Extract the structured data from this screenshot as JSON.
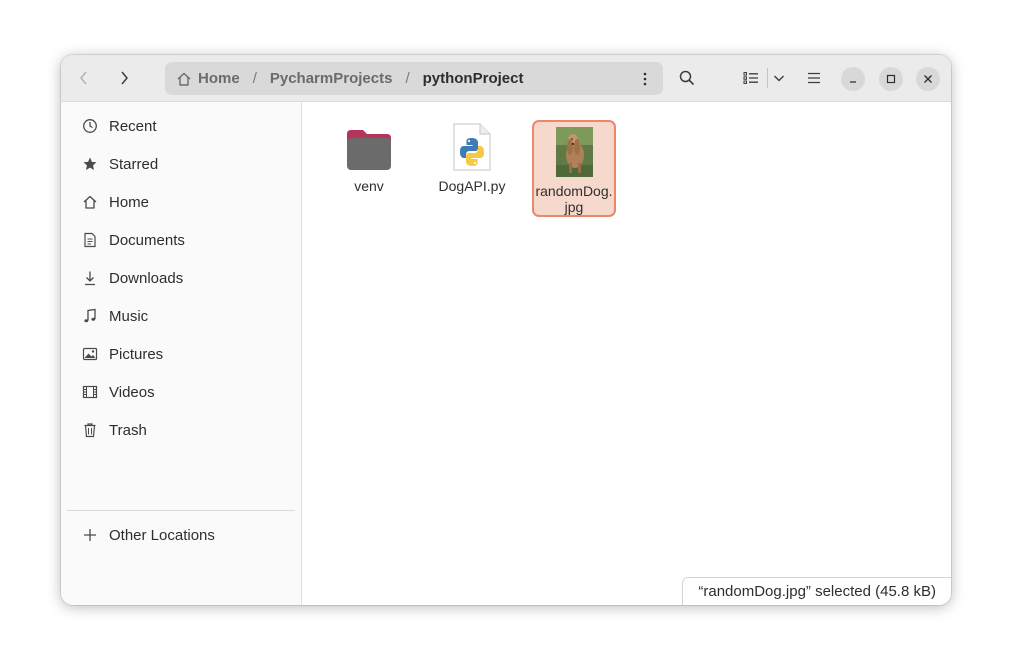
{
  "header": {
    "breadcrumbs": [
      {
        "label": "Home",
        "icon": "home-icon"
      },
      {
        "label": "PycharmProjects"
      },
      {
        "label": "pythonProject"
      }
    ],
    "separator": "/"
  },
  "sidebar": {
    "items": [
      {
        "label": "Recent",
        "icon": "clock-icon"
      },
      {
        "label": "Starred",
        "icon": "star-icon"
      },
      {
        "label": "Home",
        "icon": "home-icon"
      },
      {
        "label": "Documents",
        "icon": "document-icon"
      },
      {
        "label": "Downloads",
        "icon": "download-icon"
      },
      {
        "label": "Music",
        "icon": "music-icon"
      },
      {
        "label": "Pictures",
        "icon": "picture-icon"
      },
      {
        "label": "Videos",
        "icon": "film-icon"
      },
      {
        "label": "Trash",
        "icon": "trash-icon"
      }
    ],
    "other": {
      "label": "Other Locations",
      "icon": "plus-icon"
    }
  },
  "files": [
    {
      "name": "venv",
      "type": "folder",
      "selected": false
    },
    {
      "name": "DogAPI.py",
      "type": "python-file",
      "selected": false
    },
    {
      "name": "randomDog.jpg",
      "type": "image",
      "selected": true
    }
  ],
  "status": {
    "text": "“randomDog.jpg” selected  (45.8 kB)"
  },
  "colors": {
    "accent": "#e8896a",
    "selection_bg": "#f7d8cd",
    "folder": "#6b6b6b",
    "folder_tab": "#b5345a"
  }
}
